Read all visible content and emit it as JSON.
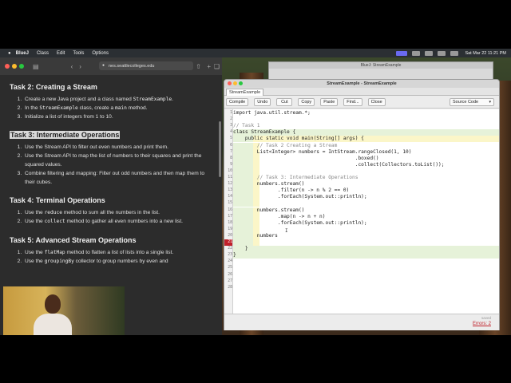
{
  "menubar": {
    "app": "BlueJ",
    "items": [
      "Class",
      "Edit",
      "Tools",
      "Options"
    ],
    "datetime": "Sat Mar 22  11:21 PM"
  },
  "browser": {
    "url": "nes.seattlecolleges.edu",
    "sections": [
      {
        "title": "Task 2: Creating a Stream",
        "items": [
          [
            "Create a new Java project and a class named ",
            {
              "code": "StreamExample"
            },
            "."
          ],
          [
            "In the ",
            {
              "code": "StreamExample"
            },
            " class, create a ",
            {
              "code": "main"
            },
            " method."
          ],
          [
            "Initialize a list of integers from 1 to 10."
          ]
        ]
      },
      {
        "title": "Task 3: Intermediate Operations",
        "highlight": true,
        "items": [
          [
            "Use the Stream API to filter out even numbers and print them."
          ],
          [
            "Use the Stream API to map the list of numbers to their squares and print the squared values."
          ],
          [
            "Combine filtering and mapping: Filter out odd numbers and then map them to their cubes."
          ]
        ]
      },
      {
        "title": "Task 4: Terminal Operations",
        "items": [
          [
            "Use the ",
            {
              "code": "reduce"
            },
            " method to sum all the numbers in the list."
          ],
          [
            "Use the ",
            {
              "code": "collect"
            },
            " method to gather all even numbers into a new list."
          ]
        ]
      },
      {
        "title": "Task 5: Advanced Stream Operations",
        "items": [
          [
            "Use the ",
            {
              "code": "flatMap"
            },
            " method to flatten a list of lists into a single list."
          ],
          [
            "Use the ",
            {
              "code": "groupingBy"
            },
            " collector to group numbers by even and"
          ]
        ]
      }
    ]
  },
  "bluej_back": {
    "title": "BlueJ: StreamExample"
  },
  "editor": {
    "title": "StreamExample - StreamExample",
    "tab": "StreamExample",
    "toolbar": [
      "Compile",
      "Undo",
      "Cut",
      "Copy",
      "Paste",
      "Find...",
      "Close"
    ],
    "view_select": "Source Code",
    "status_saved": "saved",
    "status_errors": "Errors: 2",
    "lines": [
      {
        "n": "1",
        "t": "import java.util.stream.*;",
        "bg": ""
      },
      {
        "n": "2",
        "t": "",
        "bg": ""
      },
      {
        "n": "3",
        "t": "// Task 1",
        "bg": "",
        "cls": "cmt"
      },
      {
        "n": "4",
        "t": "class StreamExample {",
        "bg": "class"
      },
      {
        "n": "5",
        "t": "    public static void main(String[] args) {",
        "bg": "class-m"
      },
      {
        "n": "6",
        "t": "        // Task 2 Creating a Stream",
        "bg": "method",
        "cls": "cmt"
      },
      {
        "n": "7",
        "t": "        List<Integer> numbers = IntStream.rangeClosed(1, 10)",
        "bg": "method"
      },
      {
        "n": "8",
        "t": "                                         .boxed()",
        "bg": "method"
      },
      {
        "n": "9",
        "t": "                                         .collect(Collectors.toList());",
        "bg": "method"
      },
      {
        "n": "10",
        "t": "",
        "bg": "method"
      },
      {
        "n": "11",
        "t": "        // Task 3: Intermediate Operations",
        "bg": "method",
        "cls": "cmt"
      },
      {
        "n": "12",
        "t": "        numbers.stream()",
        "bg": "method"
      },
      {
        "n": "13",
        "t": "               .filter(n -> n % 2 == 0)",
        "bg": "method"
      },
      {
        "n": "14",
        "t": "               .forEach(System.out::println);",
        "bg": "method"
      },
      {
        "n": "15",
        "t": "",
        "bg": "method"
      },
      {
        "n": "16",
        "t": "        numbers.stream()",
        "bg": "method"
      },
      {
        "n": "17",
        "t": "               .map(n -> n + n)",
        "bg": "method"
      },
      {
        "n": "18",
        "t": "               .forEach(System.out::println);",
        "bg": "method"
      },
      {
        "n": "19",
        "t": "",
        "bg": "method"
      },
      {
        "n": "20",
        "t": "        numbers",
        "bg": "method"
      },
      {
        "n": "21",
        "t": "",
        "bg": "method",
        "err": true
      },
      {
        "n": "22",
        "t": "    }",
        "bg": "class"
      },
      {
        "n": "23",
        "t": "}",
        "bg": "class"
      },
      {
        "n": "24",
        "t": "",
        "bg": ""
      },
      {
        "n": "25",
        "t": "",
        "bg": ""
      },
      {
        "n": "26",
        "t": "",
        "bg": ""
      },
      {
        "n": "27",
        "t": "",
        "bg": ""
      },
      {
        "n": "28",
        "t": "",
        "bg": ""
      }
    ]
  }
}
